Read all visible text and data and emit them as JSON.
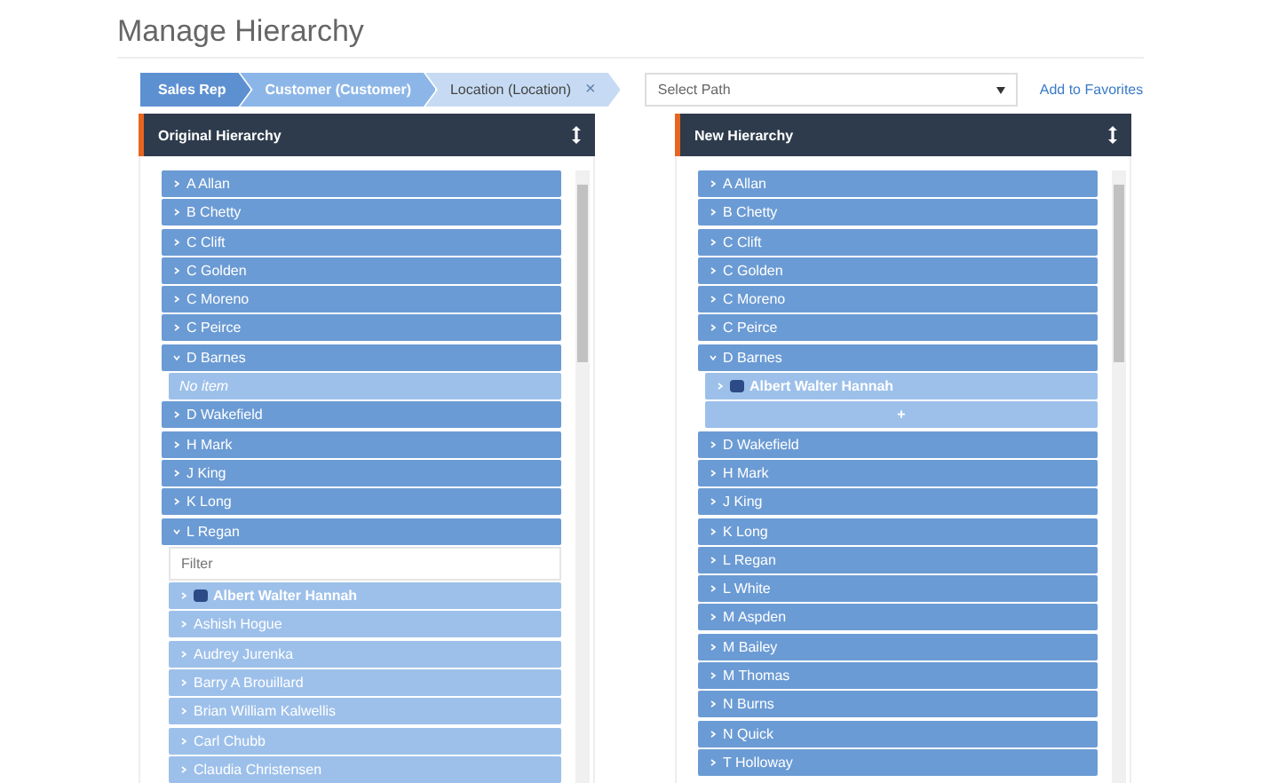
{
  "title": "Manage Hierarchy",
  "breadcrumb": [
    {
      "label": "Sales Rep"
    },
    {
      "label": "Customer (Customer)"
    },
    {
      "label": "Location (Location)",
      "close": "×"
    }
  ],
  "path_select": {
    "placeholder": "Select Path"
  },
  "favorites_link": "Add to Favorites",
  "panels": [
    {
      "title": "Original Hierarchy",
      "items": [
        {
          "label": "A Allan",
          "expanded": false
        },
        {
          "label": "B Chetty",
          "expanded": false
        },
        {
          "label": "C Clift",
          "expanded": false
        },
        {
          "label": "C Golden",
          "expanded": false
        },
        {
          "label": "C Moreno",
          "expanded": false
        },
        {
          "label": "C Peirce",
          "expanded": false
        },
        {
          "label": "D Barnes",
          "expanded": true,
          "children": [
            {
              "kind": "note",
              "label": "No item"
            }
          ]
        },
        {
          "label": "D Wakefield",
          "expanded": false
        },
        {
          "label": "H Mark",
          "expanded": false
        },
        {
          "label": "J King",
          "expanded": false
        },
        {
          "label": "K Long",
          "expanded": false
        },
        {
          "label": "L Regan",
          "expanded": true,
          "children": [
            {
              "kind": "filter",
              "placeholder": "Filter"
            },
            {
              "kind": "leaf",
              "label": "Albert Walter Hannah",
              "marked": true
            },
            {
              "kind": "leaf",
              "label": "Ashish Hogue",
              "marked": false
            },
            {
              "kind": "leaf",
              "label": "Audrey Jurenka",
              "marked": false
            },
            {
              "kind": "leaf",
              "label": "Barry A Brouillard",
              "marked": false
            },
            {
              "kind": "leaf",
              "label": "Brian William Kalwellis",
              "marked": false
            },
            {
              "kind": "leaf",
              "label": "Carl Chubb",
              "marked": false
            },
            {
              "kind": "leaf",
              "label": "Claudia Christensen",
              "marked": false
            }
          ]
        }
      ]
    },
    {
      "title": "New Hierarchy",
      "items": [
        {
          "label": "A Allan",
          "expanded": false
        },
        {
          "label": "B Chetty",
          "expanded": false
        },
        {
          "label": "C Clift",
          "expanded": false
        },
        {
          "label": "C Golden",
          "expanded": false
        },
        {
          "label": "C Moreno",
          "expanded": false
        },
        {
          "label": "C Peirce",
          "expanded": false
        },
        {
          "label": "D Barnes",
          "expanded": true,
          "children": [
            {
              "kind": "leaf",
              "label": "Albert Walter Hannah",
              "marked": true
            },
            {
              "kind": "add",
              "label": "+"
            }
          ]
        },
        {
          "label": "D Wakefield",
          "expanded": false
        },
        {
          "label": "H Mark",
          "expanded": false
        },
        {
          "label": "J King",
          "expanded": false
        },
        {
          "label": "K Long",
          "expanded": false
        },
        {
          "label": "L Regan",
          "expanded": false
        },
        {
          "label": "L White",
          "expanded": false
        },
        {
          "label": "M Aspden",
          "expanded": false
        },
        {
          "label": "M Bailey",
          "expanded": false
        },
        {
          "label": "M Thomas",
          "expanded": false
        },
        {
          "label": "N Burns",
          "expanded": false
        },
        {
          "label": "N Quick",
          "expanded": false
        },
        {
          "label": "T Holloway",
          "expanded": false
        }
      ]
    }
  ]
}
